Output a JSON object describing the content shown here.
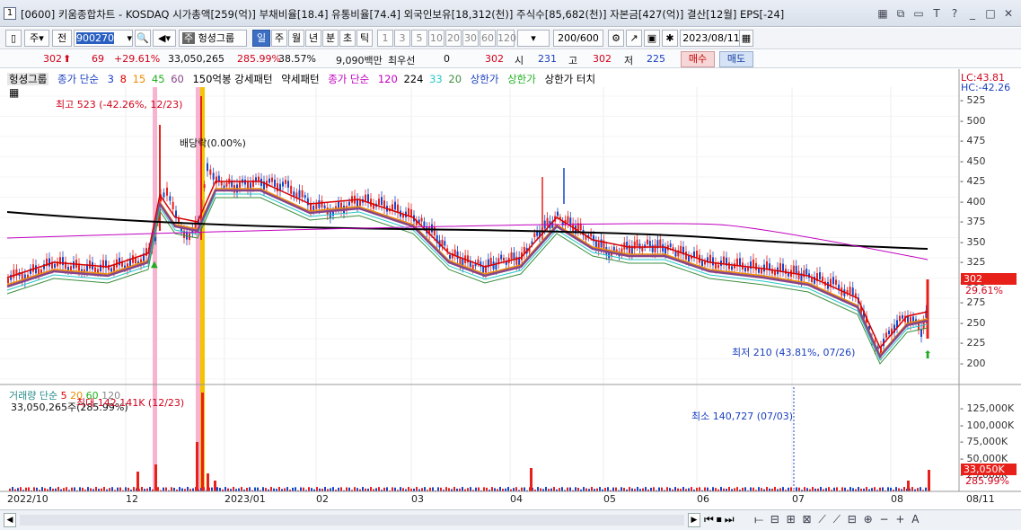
{
  "window": {
    "number": "1",
    "title": "[0600] 키움종합차트 - KOSDAQ 시가총액[259(억)] 부채비율[18.4] 유통비율[74.4] 외국인보유[18,312(천)] 주식수[85,682(천)] 자본금[427(억)] 결산[12월] EPS[-24]"
  },
  "toolbar": {
    "type_label": "주",
    "prev_label": "전",
    "code_value": "900270",
    "stock_name": "헝셩그룹",
    "period_tabs": [
      "일",
      "주",
      "월",
      "년",
      "분",
      "초",
      "틱"
    ],
    "active_period": "일",
    "interval_buttons": [
      "1",
      "3",
      "5",
      "10",
      "20",
      "30",
      "60",
      "120"
    ],
    "count_value": "200/600",
    "date_value": "2023/08/11"
  },
  "quote": {
    "price": "302",
    "change": "69",
    "change_pct": "+29.61%",
    "volume": "33,050,265",
    "volume_ratio": "285.99%",
    "turnover": "38.57%",
    "amount": "9,090백만",
    "preferred_label": "최우선",
    "preferred_value": "0",
    "ask": "302",
    "open_label": "시",
    "open": "231",
    "high_label": "고",
    "high": "302",
    "low_label": "저",
    "low": "225",
    "buy_label": "매수",
    "sell_label": "매도"
  },
  "legend": {
    "stock": "헝셩그룹",
    "ma_label": "종가 단순",
    "ma_periods": [
      "3",
      "8",
      "15",
      "45",
      "60"
    ],
    "pattern1": "150억봉 강세패턴",
    "pattern2": "약세패턴",
    "ma2_label": "종가 단순",
    "ma2_periods": [
      "120",
      "224",
      "33",
      "20"
    ],
    "limit_up": "상한가",
    "limit_up2": "상한가",
    "limit_up_touch": "상한가 터치",
    "lc": "LC:43.81",
    "hc": "HC:-42.26"
  },
  "annotations": {
    "high_note": "최고 523 (-42.26%, 12/23)",
    "dividend_note": "배당락(0.00%)",
    "low_note": "최저 210 (43.81%, 07/26)",
    "vol_high_note": "최대 142,141K (12/23)",
    "vol_low_note": "최소 140,727 (07/03)",
    "vol_legend": "거래량 단순",
    "vol_ma_periods": [
      "5",
      "20",
      "60",
      "120"
    ],
    "vol_value": "33,050,265주(285.99%)"
  },
  "price_axis": {
    "ticks": [
      "525",
      "500",
      "475",
      "450",
      "425",
      "400",
      "375",
      "350",
      "325",
      "300",
      "275",
      "250",
      "225",
      "200"
    ],
    "current": "302",
    "current_pct": "29.61%"
  },
  "volume_axis": {
    "ticks": [
      "125,000K",
      "100,000K",
      "75,000K",
      "50,000K",
      "25,000K"
    ],
    "current": "33,050K",
    "current_pct": "285.99%"
  },
  "date_axis": {
    "labels": [
      "2022/10",
      "12",
      "2023/01",
      "02",
      "03",
      "04",
      "05",
      "06",
      "07",
      "08"
    ],
    "right_label": "08/11"
  },
  "colors": {
    "up": "#e8201a",
    "down": "#1447c8",
    "ma3": "#d80000",
    "ma8": "#1f3fc8",
    "ma15": "#f08c00",
    "ma45": "#20b020",
    "ma60": "#884488",
    "ma120": "#c000c0",
    "ma224": "#000000",
    "ma33": "#28c8c8",
    "ma20": "#3f8f3f"
  }
}
